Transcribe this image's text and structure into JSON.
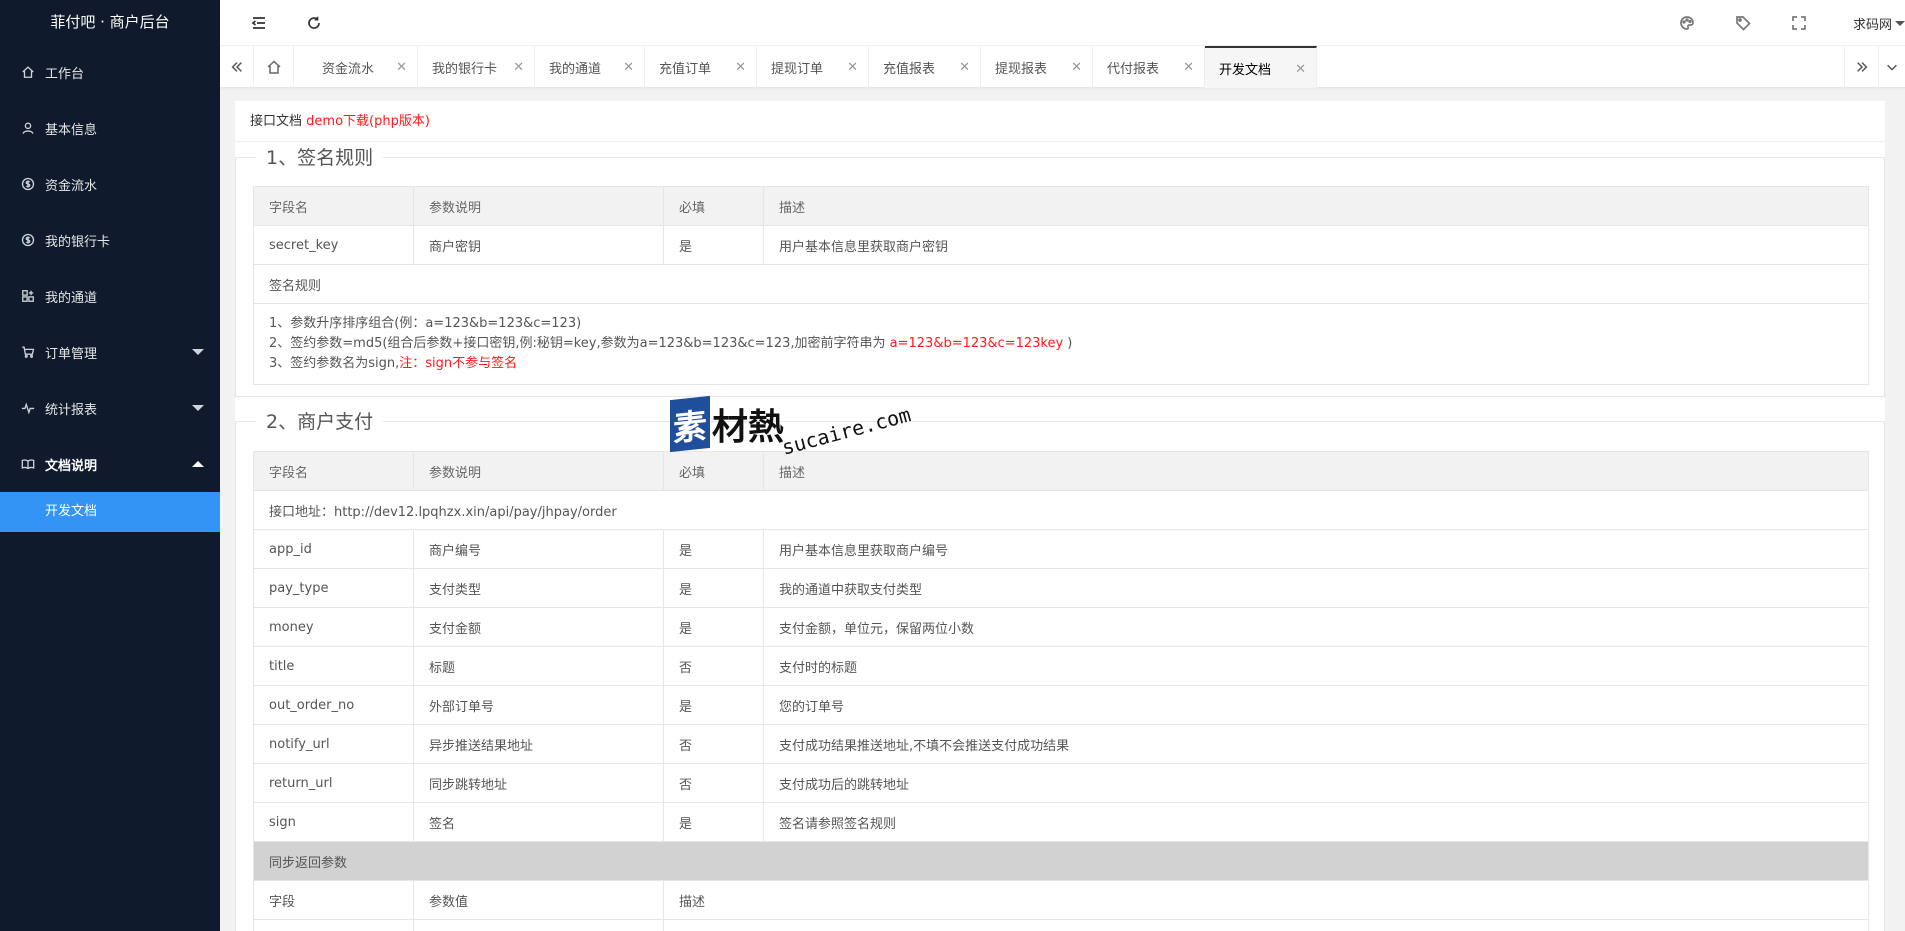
{
  "app": {
    "title": "菲付吧 · 商户后台"
  },
  "sidebar": {
    "items": [
      {
        "label": "工作台",
        "icon": "home-icon"
      },
      {
        "label": "基本信息",
        "icon": "user-icon"
      },
      {
        "label": "资金流水",
        "icon": "dollar-icon"
      },
      {
        "label": "我的银行卡",
        "icon": "dollar-icon"
      },
      {
        "label": "我的通道",
        "icon": "apps-icon"
      },
      {
        "label": "订单管理",
        "icon": "cart-icon"
      },
      {
        "label": "统计报表",
        "icon": "pulse-icon"
      },
      {
        "label": "文档说明",
        "icon": "book-icon"
      }
    ],
    "sub_items": [
      {
        "label": "开发文档"
      }
    ]
  },
  "header": {
    "user": "求码网"
  },
  "tabs": [
    {
      "label": "资金流水"
    },
    {
      "label": "我的银行卡"
    },
    {
      "label": "我的通道"
    },
    {
      "label": "充值订单"
    },
    {
      "label": "提现订单"
    },
    {
      "label": "充值报表"
    },
    {
      "label": "提现报表"
    },
    {
      "label": "代付报表"
    },
    {
      "label": "开发文档"
    }
  ],
  "doc": {
    "heading": "接口文档",
    "demo_link": "demo下载(php版本)",
    "section1": {
      "title": "1、签名规则",
      "headers": [
        "字段名",
        "参数说明",
        "必填",
        "描述"
      ],
      "row": [
        "secret_key",
        "商户密钥",
        "是",
        "用户基本信息里获取商户密钥"
      ],
      "rules_title": "签名规则",
      "rule1": "1、参数升序排序组合(例：a=123&b=123&c=123)",
      "rule2_a": "2、签约参数=md5(组合后参数+接口密钥,例:秘钥=key,参数为a=123&b=123&c=123,加密前字符串为 ",
      "rule2_red": "a=123&b=123&c=123key",
      "rule2_b": " )",
      "rule3_a": "3、签约参数名为sign,",
      "rule3_red": "注：sign不参与签名"
    },
    "section2": {
      "title": "2、商户支付",
      "headers": [
        "字段名",
        "参数说明",
        "必填",
        "描述"
      ],
      "endpoint": "接口地址：http://dev12.lpqhzx.xin/api/pay/jhpay/order",
      "rows": [
        [
          "app_id",
          "商户编号",
          "是",
          "用户基本信息里获取商户编号"
        ],
        [
          "pay_type",
          "支付类型",
          "是",
          "我的通道中获取支付类型"
        ],
        [
          "money",
          "支付金额",
          "是",
          "支付金额，单位元，保留两位小数"
        ],
        [
          "title",
          "标题",
          "否",
          "支付时的标题"
        ],
        [
          "out_order_no",
          "外部订单号",
          "是",
          "您的订单号"
        ],
        [
          "notify_url",
          "异步推送结果地址",
          "否",
          "支付成功结果推送地址,不填不会推送支付成功结果"
        ],
        [
          "return_url",
          "同步跳转地址",
          "否",
          "支付成功后的跳转地址"
        ],
        [
          "sign",
          "签名",
          "是",
          "签名请参照签名规则"
        ]
      ],
      "sync_title": "同步返回参数",
      "sync_headers": [
        "字段",
        "参数值",
        "描述"
      ]
    }
  },
  "watermark": {
    "box": "素",
    "cn": "材熱",
    "en": "sucaire.com"
  }
}
